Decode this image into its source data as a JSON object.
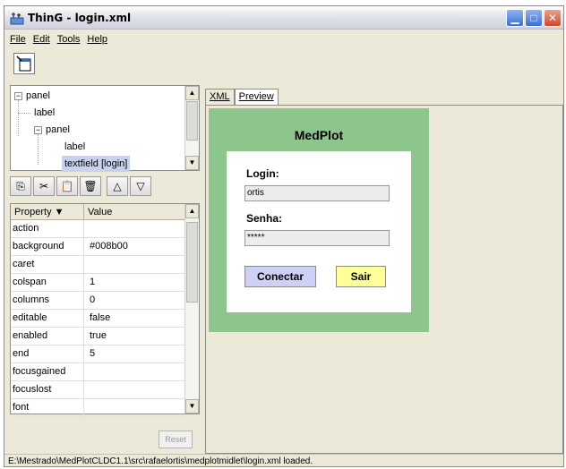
{
  "window": {
    "title": "ThinG - login.xml"
  },
  "menu": [
    "File",
    "Edit",
    "Tools",
    "Help"
  ],
  "tree": {
    "items": [
      {
        "label": "panel",
        "expandable": true
      },
      {
        "label": "label"
      },
      {
        "label": "panel",
        "expandable": true
      },
      {
        "label": "label"
      },
      {
        "label": "textfield [login]",
        "selected": true
      }
    ]
  },
  "properties": {
    "headers": [
      "Property",
      "Value"
    ],
    "rows": [
      {
        "name": "action",
        "value": ""
      },
      {
        "name": "background",
        "value": "#008b00"
      },
      {
        "name": "caret",
        "value": ""
      },
      {
        "name": "colspan",
        "value": "1"
      },
      {
        "name": "columns",
        "value": "0"
      },
      {
        "name": "editable",
        "value": "false"
      },
      {
        "name": "enabled",
        "value": "true"
      },
      {
        "name": "end",
        "value": "5"
      },
      {
        "name": "focusgained",
        "value": ""
      },
      {
        "name": "focuslost",
        "value": ""
      },
      {
        "name": "font",
        "value": ""
      }
    ],
    "reset_label": "Reset"
  },
  "tabs": [
    "XML",
    "Preview"
  ],
  "preview": {
    "title": "MedPlot",
    "login_label": "Login:",
    "login_value": "ortis",
    "password_label": "Senha:",
    "password_value": "*****",
    "connect_label": "Conectar",
    "exit_label": "Sair",
    "colors": {
      "panel": "#8dc68d",
      "connect": "#cfd0f5",
      "exit": "#ffff99"
    }
  },
  "status": "E:\\Mestrado\\MedPlotCLDC1.1\\src\\rafaelortis\\medplotmidlet\\login.xml loaded."
}
